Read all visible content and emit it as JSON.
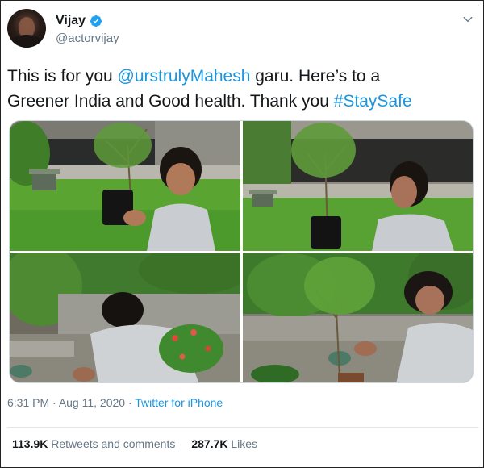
{
  "user": {
    "name": "Vijay",
    "handle": "@actorvijay"
  },
  "tweet": {
    "line1_pre": "This is for you ",
    "mention": "@urstrulyMahesh",
    "line1_post": " garu. Here’s to a",
    "line2_pre": "Greener India and Good health. Thank you ",
    "hashtag": "#StaySafe"
  },
  "meta": {
    "time": "6:31 PM",
    "separator1": " · ",
    "date": "Aug 11, 2020",
    "separator2": " · ",
    "source": "Twitter for iPhone"
  },
  "stats": {
    "retweets_count": "113.9K",
    "retweets_label": " Retweets and comments",
    "likes_count": "287.7K",
    "likes_label": " Likes"
  },
  "colors": {
    "link": "#1b95e0",
    "secondary_text": "#657786",
    "verified_badge": "#1da1f2"
  },
  "icons": {
    "verified": "verified-badge-icon",
    "menu": "chevron-down-icon"
  }
}
